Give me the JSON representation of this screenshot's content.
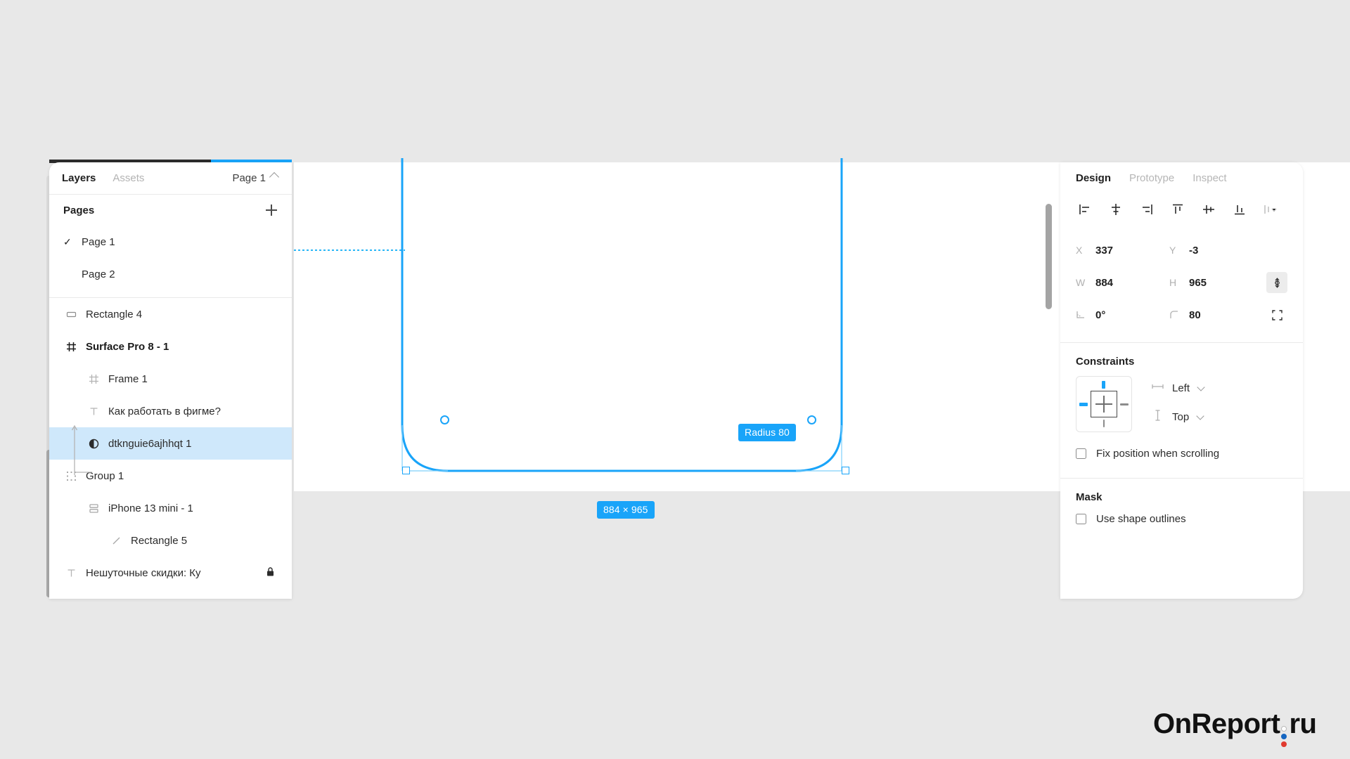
{
  "app": {
    "background_color": "#e8e8e8",
    "accent_color": "#19A4F9",
    "selection_row_color": "#cfe8fb"
  },
  "left_panel": {
    "tabs": [
      {
        "label": "Layers",
        "active": true
      },
      {
        "label": "Assets",
        "active": false
      }
    ],
    "page_selector": {
      "label": "Page 1",
      "caret_icon": "chevron-up-icon"
    },
    "pages_section": {
      "title": "Pages",
      "add_icon": "plus-icon",
      "pages": [
        {
          "label": "Page 1",
          "checked": true,
          "check_icon": "check-icon"
        },
        {
          "label": "Page 2",
          "checked": false,
          "check_icon": ""
        }
      ]
    },
    "layers": [
      {
        "label": "Rectangle 4",
        "icon": "rectangle-icon",
        "indent": 0,
        "bold": false,
        "selected": false,
        "locked": false
      },
      {
        "label": "Surface Pro 8 - 1",
        "icon": "frame-icon",
        "indent": 0,
        "bold": true,
        "selected": false,
        "locked": false
      },
      {
        "label": "Frame 1",
        "icon": "frame-icon",
        "indent": 1,
        "bold": false,
        "selected": false,
        "locked": false
      },
      {
        "label": "Как работать в фигме?",
        "icon": "text-icon",
        "indent": 1,
        "bold": false,
        "selected": false,
        "locked": false
      },
      {
        "label": "dtknguie6ajhhqt 1",
        "icon": "image-icon",
        "indent": 1,
        "bold": false,
        "selected": true,
        "locked": false
      },
      {
        "label": "Group 1",
        "icon": "group-icon",
        "indent": 0,
        "bold": false,
        "selected": false,
        "locked": false
      },
      {
        "label": "iPhone 13 mini - 1",
        "icon": "component-icon",
        "indent": 1,
        "bold": false,
        "selected": false,
        "locked": false
      },
      {
        "label": "Rectangle 5",
        "icon": "line-icon",
        "indent": 2,
        "bold": false,
        "selected": false,
        "locked": false
      },
      {
        "label": "Нешуточные скидки: Ку",
        "icon": "text-icon",
        "indent": 0,
        "bold": false,
        "selected": false,
        "locked": true,
        "lock_icon": "lock-icon"
      }
    ]
  },
  "canvas": {
    "badges": [
      {
        "id": "radius",
        "label": "Radius 80"
      },
      {
        "id": "size",
        "label": "884 × 965"
      }
    ],
    "handles": {
      "radius_handle_icon": "corner-radius-handle-icon",
      "resize_handle_icon": "resize-handle-icon"
    }
  },
  "right_panel": {
    "tabs": [
      {
        "label": "Design",
        "active": true
      },
      {
        "label": "Prototype",
        "active": false
      },
      {
        "label": "Inspect",
        "active": false
      }
    ],
    "align_buttons": [
      {
        "name": "align-left-icon"
      },
      {
        "name": "align-horizontal-center-icon"
      },
      {
        "name": "align-right-icon"
      },
      {
        "name": "align-top-icon"
      },
      {
        "name": "align-vertical-center-icon"
      },
      {
        "name": "align-bottom-icon"
      },
      {
        "name": "distribute-menu-icon"
      }
    ],
    "properties": [
      {
        "label": "X",
        "value": "337",
        "label2": "Y",
        "value2": "-3",
        "button": ""
      },
      {
        "label": "W",
        "value": "884",
        "label2": "H",
        "value2": "965",
        "button": "constrain-proportions-icon",
        "button_pressed": true
      },
      {
        "label": "∟",
        "value": "0°",
        "label2": "⌐",
        "value2": "80",
        "button": "independent-corners-icon",
        "button_pressed": false
      }
    ],
    "constraints": {
      "title": "Constraints",
      "horizontal": {
        "label": "Left",
        "icon": "horizontal-constraint-icon",
        "caret_icon": "chevron-down-icon"
      },
      "vertical": {
        "label": "Top",
        "icon": "vertical-constraint-icon",
        "caret_icon": "chevron-down-icon"
      },
      "fix_position": {
        "label": "Fix position when scrolling",
        "checked": false
      }
    },
    "mask": {
      "title": "Mask",
      "use_shape_outlines": {
        "label": "Use shape outlines",
        "checked": false
      }
    }
  },
  "logo": {
    "text_1": "OnReport",
    "text_2": "ru",
    "dot_colors": [
      "#ffffff",
      "#1565C0",
      "#E03A2F"
    ]
  }
}
